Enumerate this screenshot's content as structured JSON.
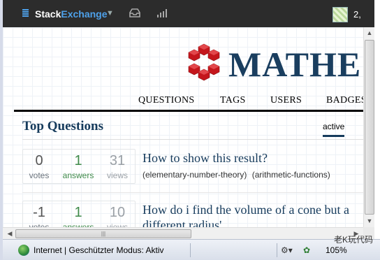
{
  "topbar": {
    "brand_stack": "Stack",
    "brand_exchange": "Exchange",
    "reputation": "2,"
  },
  "site": {
    "name": "MATHE",
    "nav": [
      "QUESTIONS",
      "TAGS",
      "USERS",
      "BADGES"
    ],
    "section_title": "Top Questions",
    "active_tab": "active"
  },
  "questions": [
    {
      "votes": "0",
      "votes_label": "votes",
      "answers": "1",
      "answers_label": "answers",
      "views": "31",
      "views_label": "views",
      "title": "How to show this result?",
      "tags": [
        "(elementary-number-theory)",
        "(arithmetic-functions)"
      ]
    },
    {
      "votes": "-1",
      "votes_label": "votes",
      "answers": "1",
      "answers_label": "answers",
      "views": "10",
      "views_label": "views",
      "title": "How do i find the volume of a cone but a different radius'",
      "tags": []
    }
  ],
  "statusbar": {
    "text": "Internet | Geschützter Modus: Aktiv",
    "zoom": "105%",
    "watermark": "老K玩代码"
  },
  "colors": {
    "brand_blue": "#163b5c",
    "answers_green": "#3f8a4a",
    "logo_red": "#c4161c"
  },
  "icons": [
    "menu-icon",
    "inbox-icon",
    "achievements-icon",
    "globe-icon",
    "zoom-icon",
    "wechat-icon"
  ]
}
